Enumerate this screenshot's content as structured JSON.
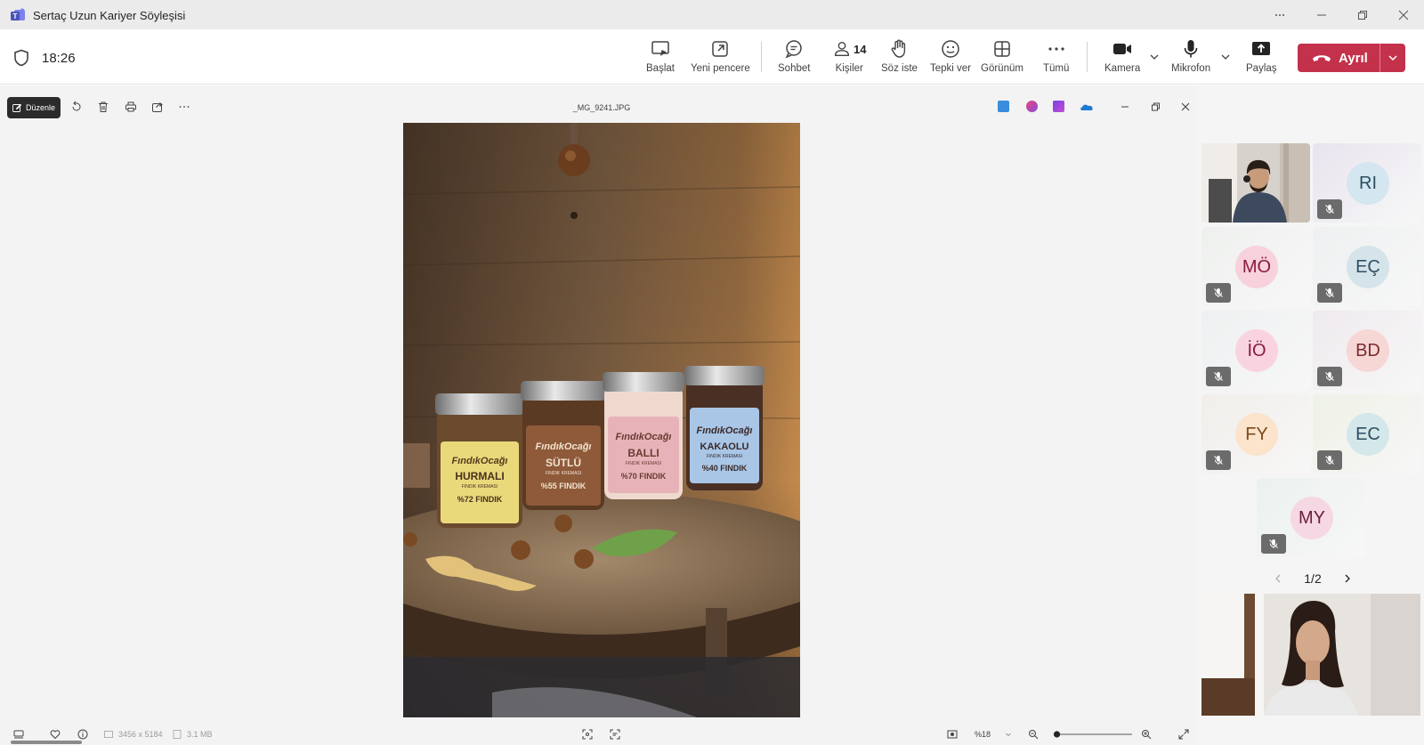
{
  "window": {
    "title": "Sertaç Uzun Kariyer Söyleşisi"
  },
  "meeting": {
    "timer": "18:26",
    "toolbar": {
      "start_label": "Başlat",
      "new_window_label": "Yeni pencere",
      "chat_label": "Sohbet",
      "people_label": "Kişiler",
      "people_count": "14",
      "raise_hand_label": "Söz iste",
      "react_label": "Tepki ver",
      "view_label": "Görünüm",
      "more_label": "Tümü",
      "camera_label": "Kamera",
      "mic_label": "Mikrofon",
      "share_label": "Paylaş",
      "leave_label": "Ayrıl"
    }
  },
  "viewer": {
    "edit_label": "Düzenle",
    "filename": "_MG_9241.JPG",
    "dimensions": "3456 x 5184",
    "filesize": "3.1 MB",
    "zoom": "%18",
    "zoom_level": 0.04,
    "jars": [
      {
        "brand": "FındıkOcağı",
        "name": "HURMALI",
        "sub": "FINDIK KREMASI",
        "pct": "%72 FINDIK",
        "color": "#e9d97a"
      },
      {
        "brand": "FındıkOcağı",
        "name": "SÜTLÜ",
        "sub": "FINDIK KREMASI",
        "pct": "%55 FINDIK",
        "color": "#8e5a3a"
      },
      {
        "brand": "FındıkOcağı",
        "name": "BALLI",
        "sub": "FINDIK KREMASI",
        "pct": "%70 FINDIK",
        "color": "#e7b3b8"
      },
      {
        "brand": "FındıkOcağı",
        "name": "KAKAOLU",
        "sub": "FINDIK KREMASI",
        "pct": "%40 FINDIK",
        "color": "#a9c6e6"
      }
    ]
  },
  "gallery": {
    "participants": [
      {
        "initials": "RI",
        "bg": "#e8e4ee",
        "avatar_bg": "#d4e6ef",
        "avatar_fg": "#2e4e63"
      },
      {
        "initials": "MÖ",
        "bg": "#eef0ee",
        "avatar_bg": "#f7d1dc",
        "avatar_fg": "#8a1b3d"
      },
      {
        "initials": "EÇ",
        "bg": "#eef0f1",
        "avatar_bg": "#d5e4ea",
        "avatar_fg": "#2e4e63"
      },
      {
        "initials": "İÖ",
        "bg": "#eef0f1",
        "avatar_bg": "#f9d4e0",
        "avatar_fg": "#8a1b3d"
      },
      {
        "initials": "BD",
        "bg": "#efeaee",
        "avatar_bg": "#f7d6d6",
        "avatar_fg": "#7a2b2b"
      },
      {
        "initials": "FY",
        "bg": "#f1eeea",
        "avatar_bg": "#fbe3cc",
        "avatar_fg": "#7a4a1a"
      },
      {
        "initials": "EC",
        "bg": "#eef1e6",
        "avatar_bg": "#d4e7ea",
        "avatar_fg": "#2e4e63"
      },
      {
        "initials": "MY",
        "bg": "#ebf1ee",
        "avatar_bg": "#f6d7e4",
        "avatar_fg": "#6b1f3e"
      }
    ],
    "page_label": "1/2"
  }
}
